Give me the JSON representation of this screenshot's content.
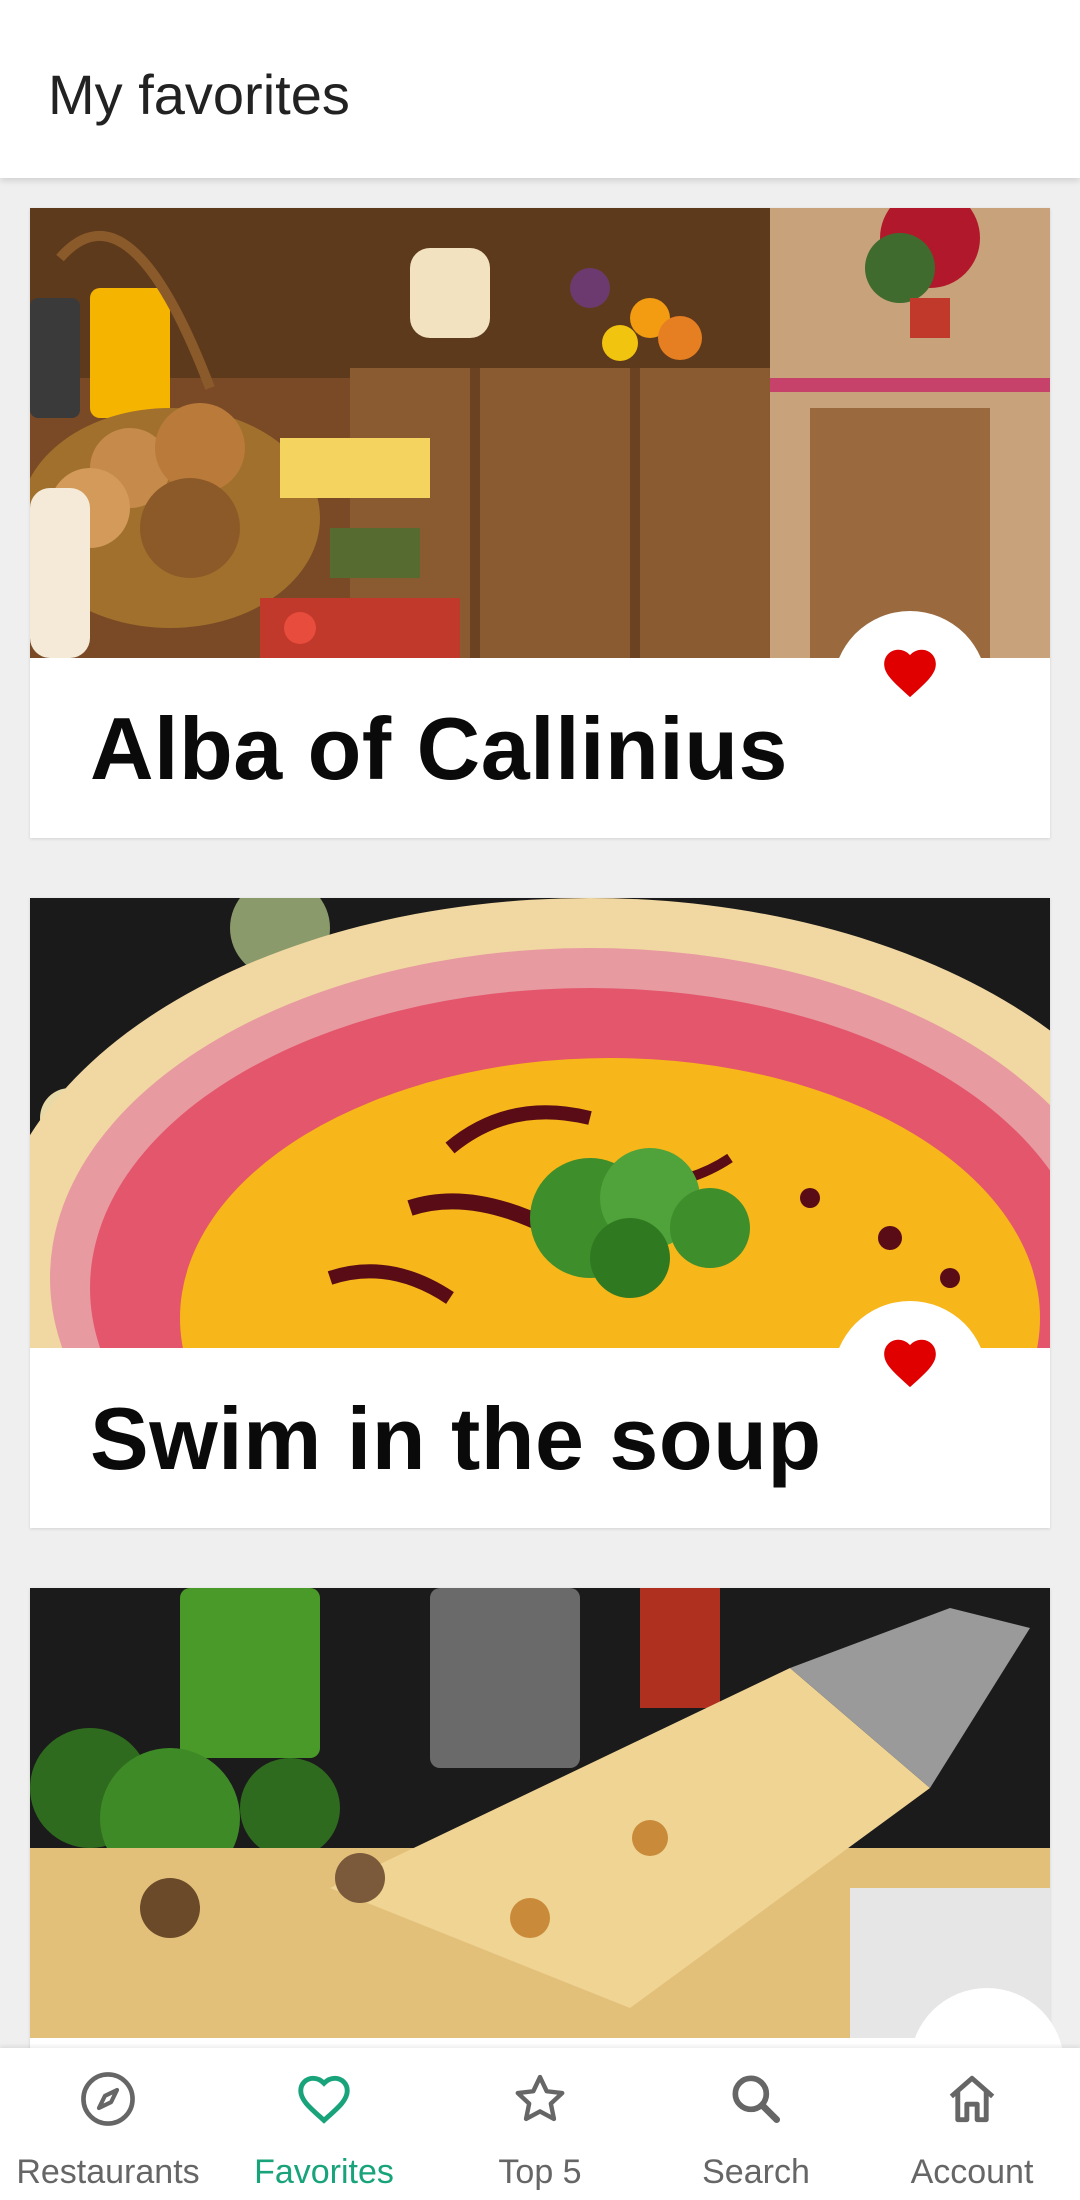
{
  "app_bar": {
    "title": "My favorites"
  },
  "restaurants": [
    {
      "name": "Alba of Callinius",
      "favorite": true,
      "image": "bakery-buffet-photo"
    },
    {
      "name": "Swim in the soup",
      "favorite": true,
      "image": "pumpkin-soup-photo"
    },
    {
      "name": "",
      "favorite": true,
      "image": "pizza-slice-photo"
    }
  ],
  "nav": {
    "items": [
      {
        "label": "Restaurants",
        "icon": "compass-icon",
        "active": false
      },
      {
        "label": "Favorites",
        "icon": "heart-outline-icon",
        "active": true
      },
      {
        "label": "Top 5",
        "icon": "star-outline-icon",
        "active": false
      },
      {
        "label": "Search",
        "icon": "search-icon",
        "active": false
      },
      {
        "label": "Account",
        "icon": "home-icon",
        "active": false
      }
    ]
  },
  "colors": {
    "active": "#18a37a",
    "inactive": "#666666",
    "favorite_heart": "#e00000"
  }
}
